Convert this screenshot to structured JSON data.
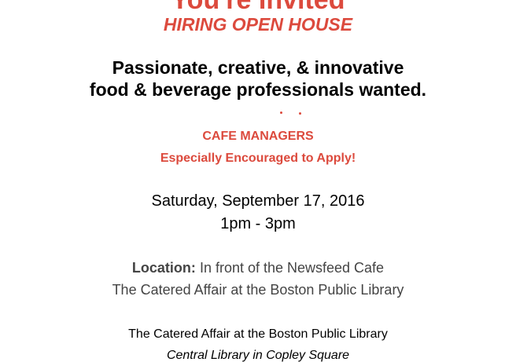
{
  "invite": {
    "title": "You're Invited",
    "subtitle": "HIRING OPEN HOUSE",
    "tagline_1": "Passionate, creative, & innovative",
    "tagline_2": "food & beverage professionals wanted.",
    "role": "CAFE MANAGERS",
    "role_note": "Especially Encouraged to Apply!",
    "date": "Saturday, September 17, 2016",
    "time": "1pm - 3pm",
    "location_label": "Location:",
    "location_value": "In front of the Newsfeed Cafe",
    "location_line2": "The Catered Affair at the Boston Public Library",
    "venue_name": "The Catered Affair at the Boston Public Library",
    "venue_sub": "Central Library in Copley Square"
  },
  "colors": {
    "accent": "#dc4a3d",
    "text": "#000000",
    "muted": "#444444"
  }
}
